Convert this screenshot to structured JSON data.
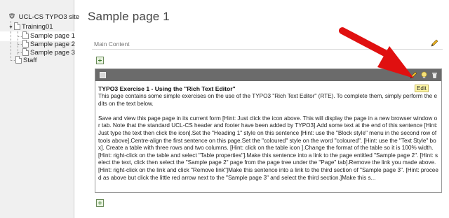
{
  "tree": {
    "site": "UCL-CS TYPO3 site",
    "folder": "Training01",
    "pages": [
      "Sample page 1",
      "Sample page 2",
      "Sample page 3"
    ],
    "staff": "Staff",
    "toggle_glyph": "▼"
  },
  "main": {
    "title": "Sample page 1",
    "section_label": "Main Content"
  },
  "content_element": {
    "title": "TYPO3 Exercise 1 - Using the \"Rich Text Editor\"",
    "paragraph1": "This page contains some simple exercises on the use of the TYPO3 \"Rich Text Editor\" (RTE). To complete them, simply perform the edits on the text below.",
    "paragraph2": "Save and view this page page in its current form [Hint: Just  click the icon above. This will display the page in a new browser window or tab. Note that the standard UCL-CS header and footer have been added by TYPO3].Add some text at the end of this sentence [Hint: Just type the text then click the icon].Set the \"Heading 1\" style on this sentence [Hint: use the \"Block style\" menu in the second row of tools above].Centre-align the first sentence on this page.Set the \"coloured\" style on the word \"coloured\". [Hint: use the \"Text Style\" box]. Create a table with three rows and two columns. [Hint: click on the table icon ].Change the format of the table so it is 100% width. [Hint: right-click on the table and select \"Table properties\"].Make this sentence into a link to the page entitled \"Sample page 2\". [Hint: select the text, click then select the \"Sample page 2\" page from the page tree under the \"Page\" tab].Remove the link you made above. [Hint: right-click on the link and click \"Remove link\"]Make this sentence into a link to the third section of \"Sample page 3\". [Hint: proceed as above but click the little red arrow next to the \"Sample page 3\" and select the third section.]Make this s..."
  },
  "tooltip": "Edit",
  "icons": {
    "site": "typo3-site-icon",
    "page": "page-icon",
    "edit": "pencil-icon",
    "hide": "lightbulb-icon",
    "delete": "trash-icon",
    "new": "new-content-icon",
    "arrow": "red-arrow-annotation"
  },
  "colors": {
    "ce_header": "#6b6b6b",
    "arrow": "#e01010",
    "tooltip_bg": "#fff7a8"
  }
}
